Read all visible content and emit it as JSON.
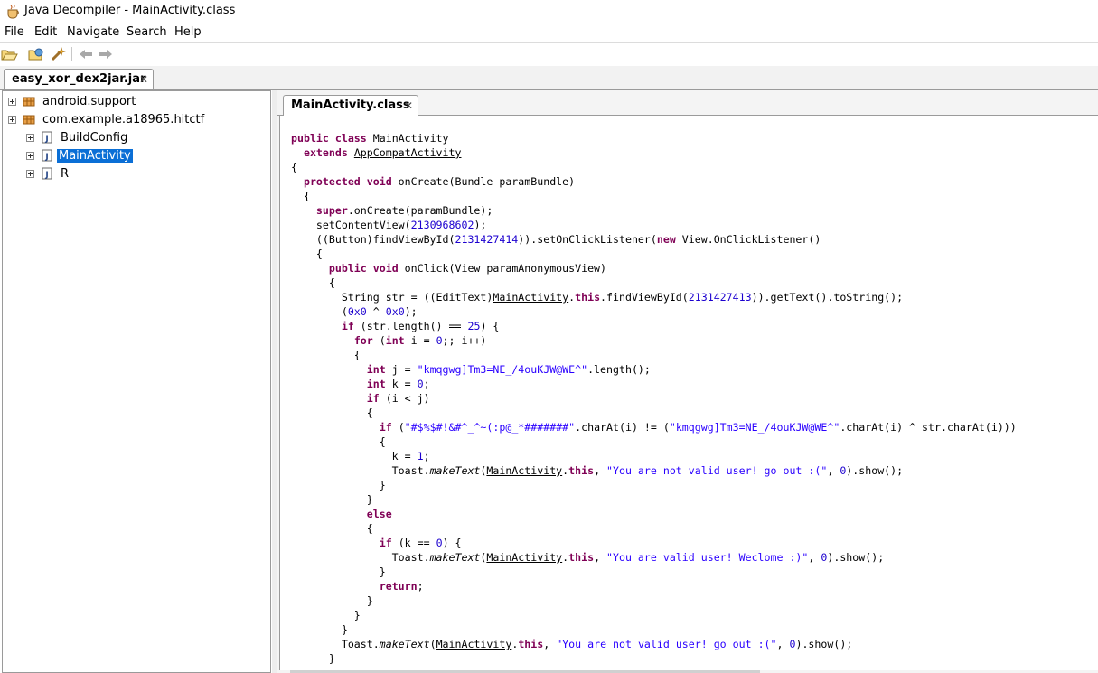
{
  "window": {
    "title": "Java Decompiler - MainActivity.class"
  },
  "menu": [
    "File",
    "Edit",
    "Navigate",
    "Search",
    "Help"
  ],
  "toolbar": {
    "buttons": [
      "open-file-icon",
      "open-type-icon",
      "wand-icon",
      "back-arrow-icon",
      "forward-arrow-icon"
    ]
  },
  "file_tab": {
    "label": "easy_xor_dex2jar.jar",
    "close": "✕"
  },
  "tree": [
    {
      "label": "android.support",
      "type": "package",
      "indent": 0
    },
    {
      "label": "com.example.a18965.hitctf",
      "type": "package",
      "indent": 0
    },
    {
      "label": "BuildConfig",
      "type": "class",
      "indent": 1
    },
    {
      "label": "MainActivity",
      "type": "class",
      "indent": 1,
      "selected": true
    },
    {
      "label": "R",
      "type": "class",
      "indent": 1
    }
  ],
  "editor_tab": {
    "label": "MainActivity.class",
    "close": "✕"
  },
  "code_lines": [
    [
      [
        "kw",
        "public class "
      ],
      [
        "",
        "MainActivity"
      ]
    ],
    [
      [
        "",
        "  "
      ],
      [
        "kw",
        "extends "
      ],
      [
        "ref",
        "AppCompatActivity"
      ]
    ],
    [
      [
        "",
        "{"
      ]
    ],
    [
      [
        "",
        "  "
      ],
      [
        "kw",
        "protected void "
      ],
      [
        "",
        "onCreate(Bundle paramBundle)"
      ]
    ],
    [
      [
        "",
        "  {"
      ]
    ],
    [
      [
        "",
        "    "
      ],
      [
        "kw",
        "super"
      ],
      [
        "",
        ".onCreate(paramBundle);"
      ]
    ],
    [
      [
        "",
        "    setContentView("
      ],
      [
        "num",
        "2130968602"
      ],
      [
        "",
        ");"
      ]
    ],
    [
      [
        "",
        "    ((Button)findViewById("
      ],
      [
        "num",
        "2131427414"
      ],
      [
        "",
        "))."
      ],
      [
        "",
        "setOnClickListener("
      ],
      [
        "kw",
        "new "
      ],
      [
        "",
        "View.OnClickListener()"
      ]
    ],
    [
      [
        "",
        "    {"
      ]
    ],
    [
      [
        "",
        "      "
      ],
      [
        "kw",
        "public void "
      ],
      [
        "",
        "onClick(View paramAnonymousView)"
      ]
    ],
    [
      [
        "",
        "      {"
      ]
    ],
    [
      [
        "",
        "        String str = ((EditText)"
      ],
      [
        "ref",
        "MainActivity"
      ],
      [
        "",
        "."
      ],
      [
        "kw",
        "this"
      ],
      [
        "",
        ".findViewById("
      ],
      [
        "num",
        "2131427413"
      ],
      [
        "",
        "))."
      ],
      [
        "",
        "getText().toString();"
      ]
    ],
    [
      [
        "",
        "        ("
      ],
      [
        "num",
        "0x0"
      ],
      [
        "",
        " ^ "
      ],
      [
        "num",
        "0x0"
      ],
      [
        "",
        ");"
      ]
    ],
    [
      [
        "",
        "        "
      ],
      [
        "kw",
        "if "
      ],
      [
        "",
        "(str.length() == "
      ],
      [
        "num",
        "25"
      ],
      [
        "",
        ") {"
      ]
    ],
    [
      [
        "",
        "          "
      ],
      [
        "kw",
        "for "
      ],
      [
        "",
        "("
      ],
      [
        "kw",
        "int "
      ],
      [
        "",
        "i = "
      ],
      [
        "num",
        "0"
      ],
      [
        "",
        ";; i++)"
      ]
    ],
    [
      [
        "",
        "          {"
      ]
    ],
    [
      [
        "",
        "            "
      ],
      [
        "kw",
        "int "
      ],
      [
        "",
        "j = "
      ],
      [
        "str",
        "\"kmqgwg]Tm3=NE_/4ouKJW@WE^\""
      ],
      [
        "",
        ".length();"
      ]
    ],
    [
      [
        "",
        "            "
      ],
      [
        "kw",
        "int "
      ],
      [
        "",
        "k = "
      ],
      [
        "num",
        "0"
      ],
      [
        "",
        ";"
      ]
    ],
    [
      [
        "",
        "            "
      ],
      [
        "kw",
        "if "
      ],
      [
        "",
        "(i < j)"
      ]
    ],
    [
      [
        "",
        "            {"
      ]
    ],
    [
      [
        "",
        "              "
      ],
      [
        "kw",
        "if "
      ],
      [
        "",
        "("
      ],
      [
        "str",
        "\"#$%$#!&#^_^~(:p@_*#######\""
      ],
      [
        "",
        ".charAt(i) != ("
      ],
      [
        "str",
        "\"kmqgwg]Tm3=NE_/4ouKJW@WE^\""
      ],
      [
        "",
        ".charAt(i) ^ str.charAt(i)))"
      ]
    ],
    [
      [
        "",
        "              {"
      ]
    ],
    [
      [
        "",
        "                k = "
      ],
      [
        "num",
        "1"
      ],
      [
        "",
        ";"
      ]
    ],
    [
      [
        "",
        "                Toast."
      ],
      [
        "it",
        "makeText"
      ],
      [
        "",
        "("
      ],
      [
        "ref",
        "MainActivity"
      ],
      [
        "",
        "."
      ],
      [
        "kw",
        "this"
      ],
      [
        "",
        ", "
      ],
      [
        "str",
        "\"You are not valid user! go out :(\""
      ],
      [
        "",
        ", "
      ],
      [
        "num",
        "0"
      ],
      [
        "",
        ").show();"
      ]
    ],
    [
      [
        "",
        "              }"
      ]
    ],
    [
      [
        "",
        "            }"
      ]
    ],
    [
      [
        "",
        "            "
      ],
      [
        "kw",
        "else"
      ]
    ],
    [
      [
        "",
        "            {"
      ]
    ],
    [
      [
        "",
        "              "
      ],
      [
        "kw",
        "if "
      ],
      [
        "",
        "(k == "
      ],
      [
        "num",
        "0"
      ],
      [
        "",
        ") {"
      ]
    ],
    [
      [
        "",
        "                Toast."
      ],
      [
        "it",
        "makeText"
      ],
      [
        "",
        "("
      ],
      [
        "ref",
        "MainActivity"
      ],
      [
        "",
        "."
      ],
      [
        "kw",
        "this"
      ],
      [
        "",
        ", "
      ],
      [
        "str",
        "\"You are valid user! Weclome :)\""
      ],
      [
        "",
        ", "
      ],
      [
        "num",
        "0"
      ],
      [
        "",
        ").show();"
      ]
    ],
    [
      [
        "",
        "              }"
      ]
    ],
    [
      [
        "",
        "              "
      ],
      [
        "kw",
        "return"
      ],
      [
        "",
        ";"
      ]
    ],
    [
      [
        "",
        "            }"
      ]
    ],
    [
      [
        "",
        "          }"
      ]
    ],
    [
      [
        "",
        "        }"
      ]
    ],
    [
      [
        "",
        "        Toast."
      ],
      [
        "it",
        "makeText"
      ],
      [
        "",
        "("
      ],
      [
        "ref",
        "MainActivity"
      ],
      [
        "",
        "."
      ],
      [
        "kw",
        "this"
      ],
      [
        "",
        ", "
      ],
      [
        "str",
        "\"You are not valid user! go out :(\""
      ],
      [
        "",
        ", "
      ],
      [
        "num",
        "0"
      ],
      [
        "",
        ").show();"
      ]
    ],
    [
      [
        "",
        "      }"
      ]
    ]
  ]
}
